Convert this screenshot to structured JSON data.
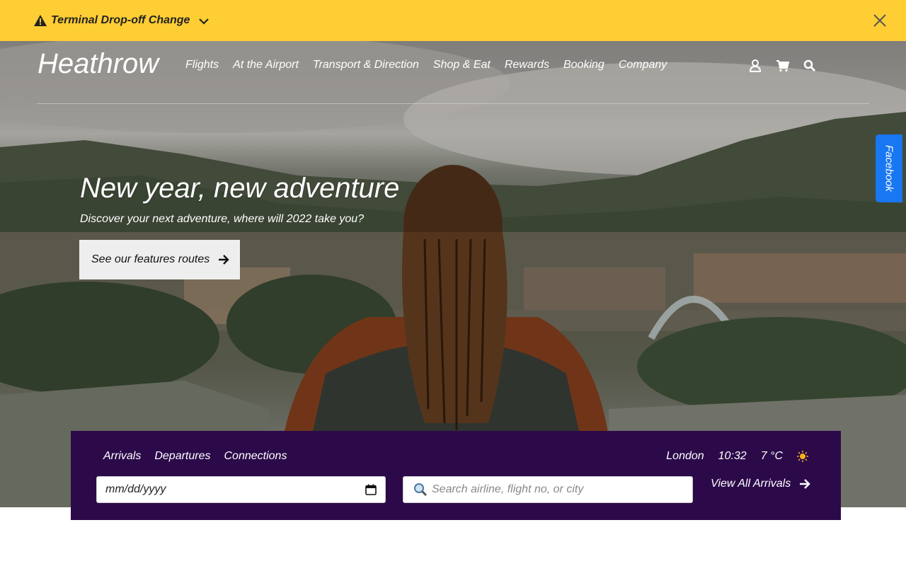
{
  "alert": {
    "title": "Terminal Drop-off Change",
    "icons": [
      "warning-icon",
      "chevron-down-icon",
      "close-icon"
    ],
    "background": "#ffce34"
  },
  "header": {
    "logo": "Heathrow",
    "nav": [
      "Flights",
      "At the Airport",
      "Transport & Direction",
      "Shop & Eat",
      "Rewards",
      "Booking",
      "Company"
    ],
    "icons": [
      "user-icon",
      "cart-icon",
      "search-icon"
    ]
  },
  "social": {
    "facebook_label": "Facebook",
    "color": "#1877f2"
  },
  "hero": {
    "title": "New year, new adventure",
    "subtitle": "Discover your next adventure, where will 2022 take you?",
    "cta_label": "See our features routes"
  },
  "flights": {
    "tabs": [
      "Arrivals",
      "Departures",
      "Connections"
    ],
    "city": "London",
    "time": "10:32",
    "temperature": "7 °C",
    "weather_icon": "sun-icon",
    "date_placeholder": "mm/dd/yyyy",
    "search_placeholder": "Search airline, flight no, or city",
    "view_all_label": "View All Arrivals",
    "panel_color": "#2c0a4a"
  }
}
